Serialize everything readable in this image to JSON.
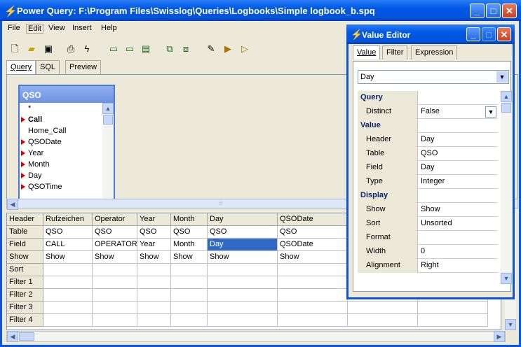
{
  "window": {
    "title": "Power Query: F:\\Program Files\\Swisslog\\Queries\\Logbooks\\Simple logbook_b.spq"
  },
  "menu": [
    "File",
    "Edit",
    "View",
    "Insert",
    "Help"
  ],
  "toolbar": [
    "new-icon",
    "open-icon",
    "save-icon",
    "print-icon",
    "run-icon",
    "add-table-icon",
    "remove-table-icon",
    "table-props-icon",
    "join-icon",
    "delete-join-icon",
    "edit-icon",
    "add-field-icon",
    "remove-field-icon"
  ],
  "tabs": [
    "Query",
    "SQL",
    "Preview"
  ],
  "table_box": {
    "title": "QSO",
    "fields": [
      {
        "name": "*",
        "key": false
      },
      {
        "name": "Call",
        "key": true
      },
      {
        "name": "Home_Call",
        "key": false
      },
      {
        "name": "QSODate",
        "key": true
      },
      {
        "name": "Year",
        "key": true
      },
      {
        "name": "Month",
        "key": true
      },
      {
        "name": "Day",
        "key": true
      },
      {
        "name": "QSOTime",
        "key": true
      }
    ]
  },
  "grid": {
    "columns": [
      "Rufzeichen",
      "Operator",
      "Year",
      "Month",
      "Day",
      "QSODate",
      "",
      ""
    ],
    "rows": [
      {
        "label": "Header",
        "cells": [
          "Rufzeichen",
          "Operator",
          "Year",
          "Month",
          "Day",
          "QSODate",
          "",
          ""
        ]
      },
      {
        "label": "Table",
        "cells": [
          "QSO",
          "QSO",
          "QSO",
          "QSO",
          "QSO",
          "QSO",
          "",
          ""
        ]
      },
      {
        "label": "Field",
        "cells": [
          "CALL",
          "OPERATOR",
          "Year",
          "Month",
          "Day",
          "QSODate",
          "",
          ""
        ]
      },
      {
        "label": "Show",
        "cells": [
          "Show",
          "Show",
          "Show",
          "Show",
          "Show",
          "Show",
          "",
          ""
        ]
      },
      {
        "label": "Sort",
        "cells": [
          "",
          "",
          "",
          "",
          "",
          "",
          "",
          ""
        ]
      },
      {
        "label": "Filter 1",
        "cells": [
          "",
          "",
          "",
          "",
          "",
          "",
          "",
          ""
        ]
      },
      {
        "label": "Filter 2",
        "cells": [
          "",
          "",
          "",
          "",
          "",
          "",
          "",
          ""
        ]
      },
      {
        "label": "Filter 3",
        "cells": [
          "",
          "",
          "",
          "",
          "",
          "",
          "",
          ""
        ]
      },
      {
        "label": "Filter 4",
        "cells": [
          "",
          "",
          "",
          "",
          "",
          "",
          "",
          ""
        ]
      }
    ],
    "selected": {
      "row": 2,
      "col": 4
    }
  },
  "value_editor": {
    "title": "Value Editor",
    "tabs": [
      "Value",
      "Filter",
      "Expression"
    ],
    "combo": "Day",
    "props": [
      {
        "label": "Query",
        "value": "",
        "cat": true
      },
      {
        "label": "Distinct",
        "value": "False",
        "cat": false,
        "dropdown": true
      },
      {
        "label": "Value",
        "value": "",
        "cat": true
      },
      {
        "label": "Header",
        "value": "Day",
        "cat": false
      },
      {
        "label": "Table",
        "value": "QSO",
        "cat": false
      },
      {
        "label": "Field",
        "value": "Day",
        "cat": false
      },
      {
        "label": "Type",
        "value": "Integer",
        "cat": false
      },
      {
        "label": "Display",
        "value": "",
        "cat": true
      },
      {
        "label": "Show",
        "value": "Show",
        "cat": false
      },
      {
        "label": "Sort",
        "value": "Unsorted",
        "cat": false
      },
      {
        "label": "Format",
        "value": "",
        "cat": false
      },
      {
        "label": "Width",
        "value": "0",
        "cat": false
      },
      {
        "label": "Alignment",
        "value": "Right",
        "cat": false
      }
    ]
  }
}
